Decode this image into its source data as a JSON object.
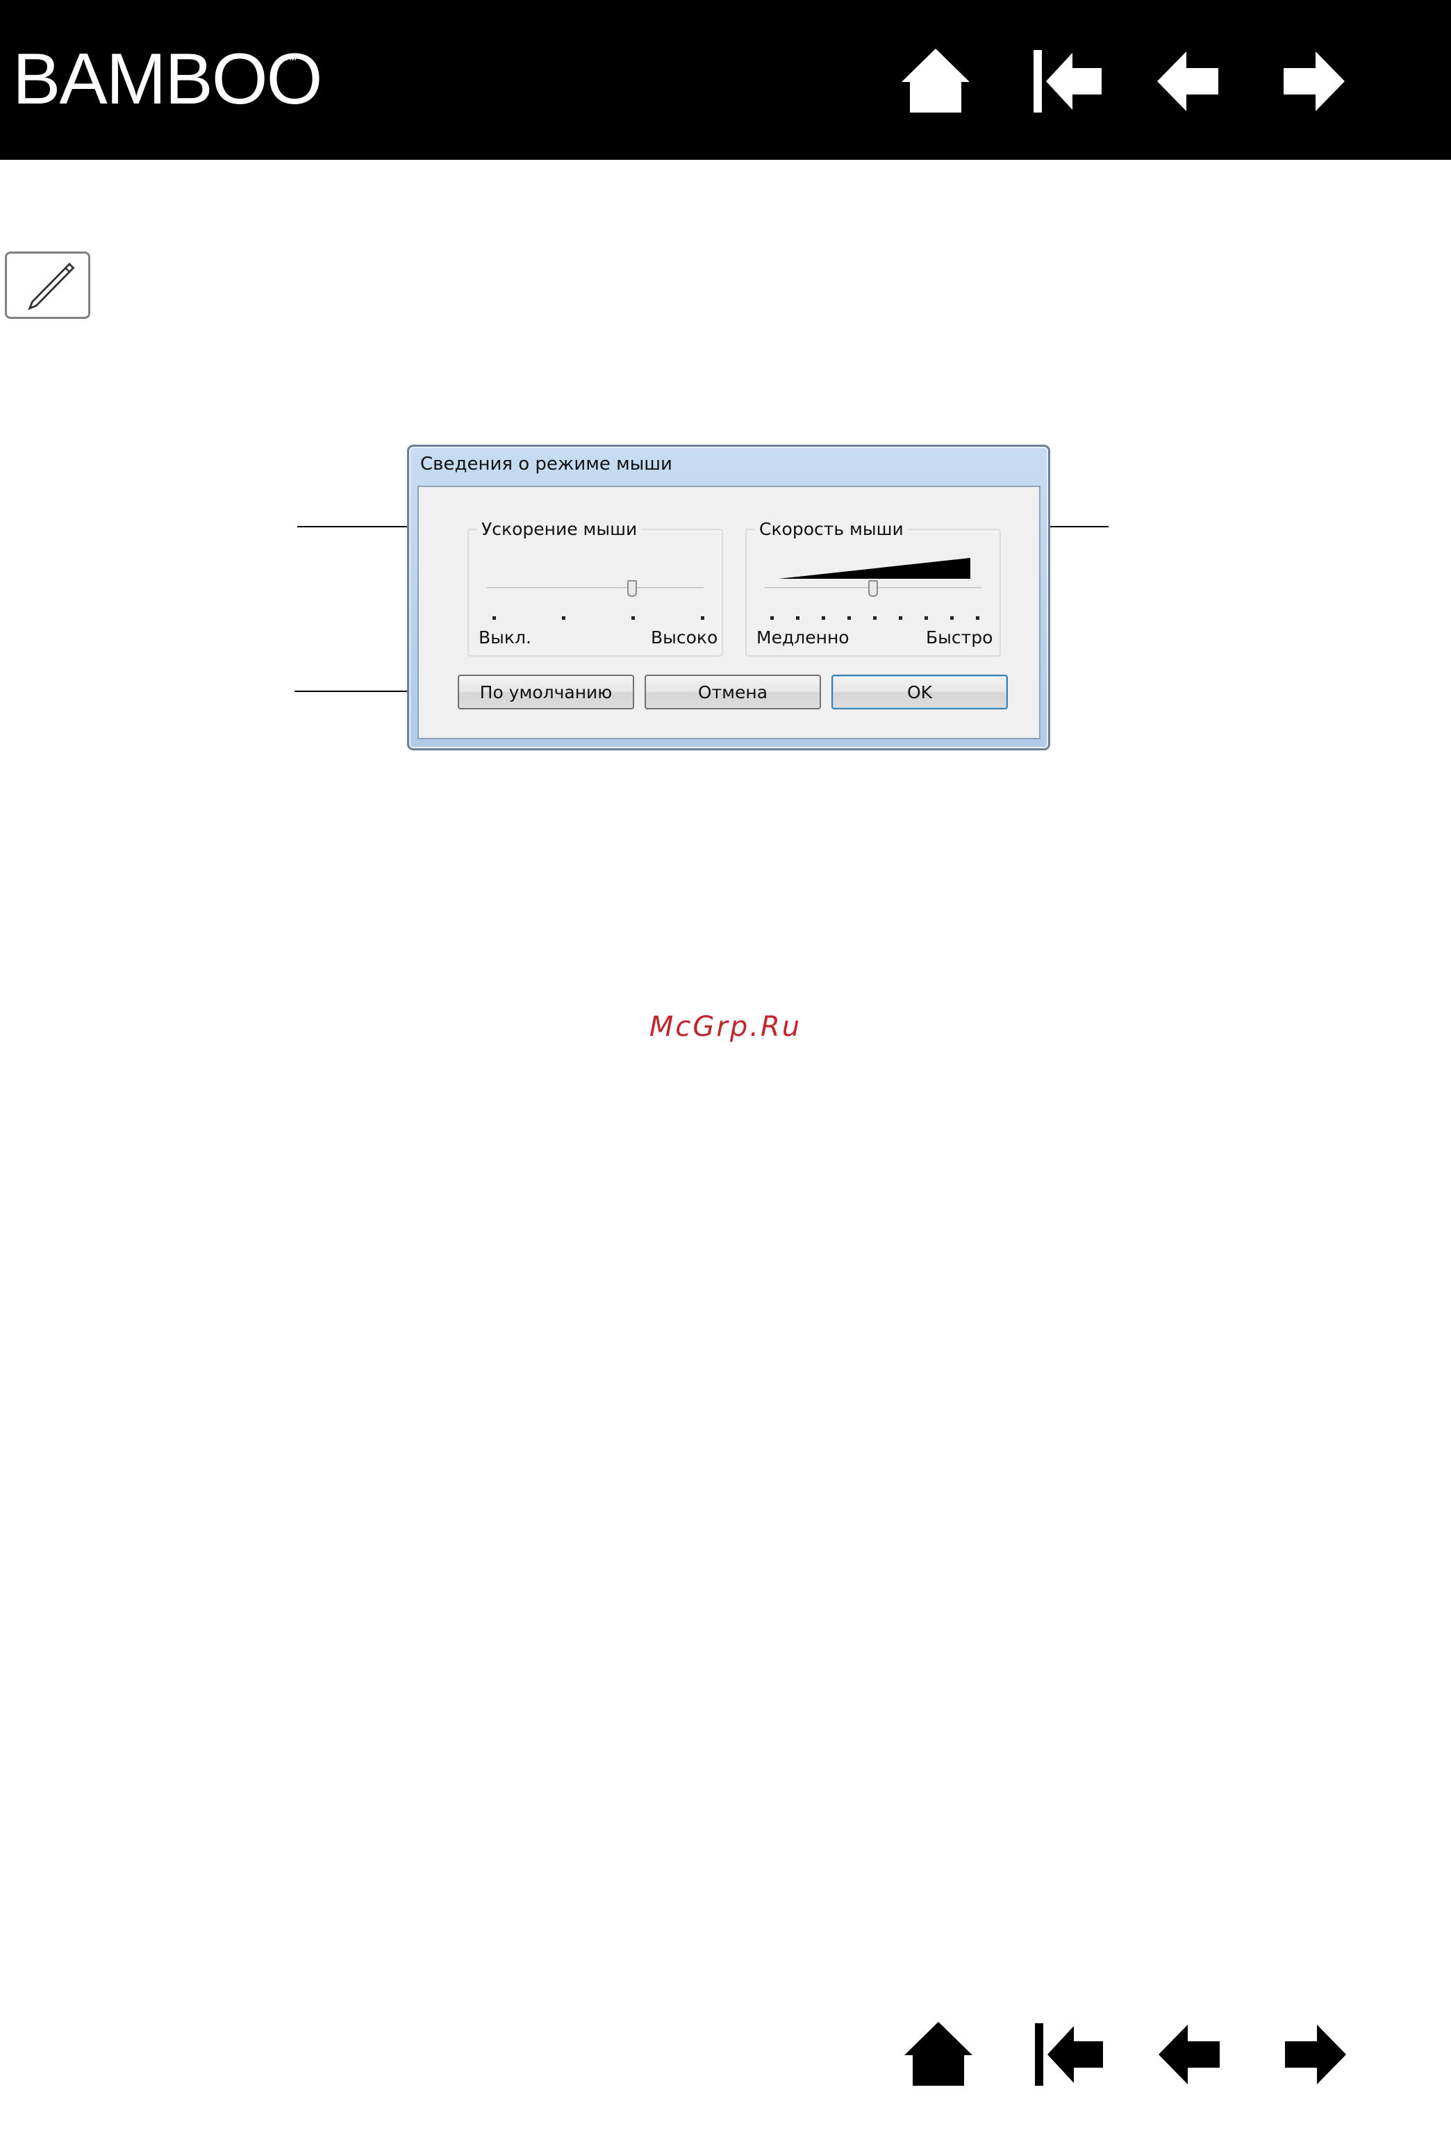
{
  "header": {
    "brand": "BAMBOO",
    "brand_tm": "™",
    "bg_color": "#000000"
  },
  "nav_icons": [
    "home-icon",
    "first-page-icon",
    "previous-page-icon",
    "next-page-icon"
  ],
  "mode_icon": "pen-icon",
  "dialog": {
    "title": "Сведения о режиме мыши",
    "acceleration": {
      "legend": "Ускорение мыши",
      "min_label": "Выкл.",
      "max_label": "Высоко",
      "value_fraction": 0.67
    },
    "speed": {
      "legend": "Скорость мыши",
      "min_label": "Медленно",
      "max_label": "Быстро",
      "value_fraction": 0.5
    },
    "buttons": {
      "default": "По умолчанию",
      "cancel": "Отмена",
      "ok": "OK"
    }
  },
  "watermark": {
    "text": "McGrp.Ru",
    "color": "#c0272d"
  }
}
